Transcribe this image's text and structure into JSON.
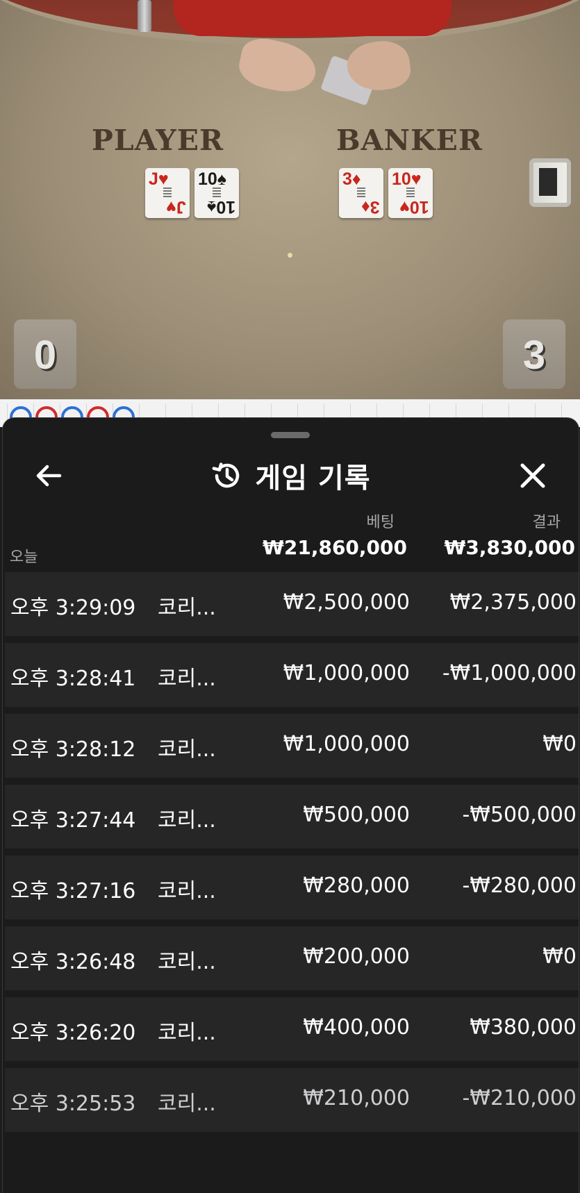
{
  "table": {
    "player_label": "PLAYER",
    "banker_label": "BANKER",
    "player_cards": [
      {
        "rank": "J",
        "suit": "♥",
        "color": "red"
      },
      {
        "rank": "10",
        "suit": "♠",
        "color": "black"
      }
    ],
    "banker_cards": [
      {
        "rank": "3",
        "suit": "♦",
        "color": "red"
      },
      {
        "rank": "10",
        "suit": "♥",
        "color": "red"
      }
    ],
    "player_score": "0",
    "banker_score": "3"
  },
  "road": {
    "dot_colors": [
      "#2d6fd6",
      "#d22b2b",
      "#2d6fd6",
      "#d22b2b",
      "#2d6fd6"
    ]
  },
  "sheet": {
    "title": "게임 기록",
    "back_icon": "arrow-left-icon",
    "history_icon": "history-clock-icon",
    "close_icon": "close-icon",
    "bet_label": "베팅",
    "result_label": "결과",
    "today_label": "오늘",
    "total_bet": "₩21,860,000",
    "total_result": "₩3,830,000",
    "rows": [
      {
        "time": "오후 3:29:09",
        "game": "코리...",
        "bet": "₩2,500,000",
        "result": "₩2,375,000"
      },
      {
        "time": "오후 3:28:41",
        "game": "코리...",
        "bet": "₩1,000,000",
        "result": "-₩1,000,000"
      },
      {
        "time": "오후 3:28:12",
        "game": "코리...",
        "bet": "₩1,000,000",
        "result": "₩0"
      },
      {
        "time": "오후 3:27:44",
        "game": "코리...",
        "bet": "₩500,000",
        "result": "-₩500,000"
      },
      {
        "time": "오후 3:27:16",
        "game": "코리...",
        "bet": "₩280,000",
        "result": "-₩280,000"
      },
      {
        "time": "오후 3:26:48",
        "game": "코리...",
        "bet": "₩200,000",
        "result": "₩0"
      },
      {
        "time": "오후 3:26:20",
        "game": "코리...",
        "bet": "₩400,000",
        "result": "₩380,000"
      },
      {
        "time": "오후 3:25:53",
        "game": "코리...",
        "bet": "₩210,000",
        "result": "-₩210,000"
      }
    ]
  }
}
